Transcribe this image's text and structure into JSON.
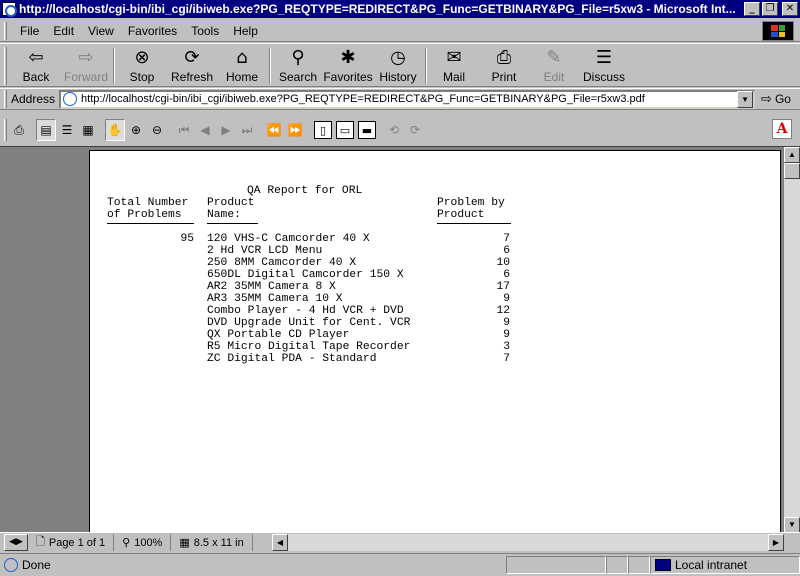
{
  "window": {
    "title": "http://localhost/cgi-bin/ibi_cgi/ibiweb.exe?PG_REQTYPE=REDIRECT&PG_Func=GETBINARY&PG_File=r5xw3 - Microsoft Int...",
    "minimize": "_",
    "restore": "❐",
    "close": "✕"
  },
  "menu": [
    "File",
    "Edit",
    "View",
    "Favorites",
    "Tools",
    "Help"
  ],
  "toolbar": [
    {
      "label": "Back",
      "icon": "back-arrow-icon",
      "glyph": "⇦",
      "enabled": true,
      "dropdown": true
    },
    {
      "label": "Forward",
      "icon": "forward-arrow-icon",
      "glyph": "⇨",
      "enabled": false,
      "dropdown": false
    },
    {
      "label": "Stop",
      "icon": "stop-icon",
      "glyph": "⊗",
      "enabled": true
    },
    {
      "label": "Refresh",
      "icon": "refresh-icon",
      "glyph": "⟳",
      "enabled": true
    },
    {
      "label": "Home",
      "icon": "home-icon",
      "glyph": "⌂",
      "enabled": true
    },
    {
      "label": "Search",
      "icon": "search-icon",
      "glyph": "⚲",
      "enabled": true
    },
    {
      "label": "Favorites",
      "icon": "favorites-icon",
      "glyph": "✱",
      "enabled": true
    },
    {
      "label": "History",
      "icon": "history-icon",
      "glyph": "◷",
      "enabled": true
    },
    {
      "label": "Mail",
      "icon": "mail-icon",
      "glyph": "✉",
      "enabled": true
    },
    {
      "label": "Print",
      "icon": "print-icon",
      "glyph": "⎙",
      "enabled": true
    },
    {
      "label": "Edit",
      "icon": "edit-icon",
      "glyph": "✎",
      "enabled": false
    },
    {
      "label": "Discuss",
      "icon": "discuss-icon",
      "glyph": "☰",
      "enabled": true
    }
  ],
  "address": {
    "label": "Address",
    "url": "http://localhost/cgi-bin/ibi_cgi/ibiweb.exe?PG_REQTYPE=REDIRECT&PG_Func=GETBINARY&PG_File=r5xw3.pdf",
    "go_label": "Go"
  },
  "report": {
    "title": "QA Report for ORL",
    "headers": {
      "col1_line1": "Total Number",
      "col1_line2": "of Problems",
      "col2_line1": "Product",
      "col2_line2": "Name:",
      "col3_line1": "Problem by",
      "col3_line2": "Product"
    },
    "total": "95",
    "rows": [
      {
        "product": "120 VHS-C Camcorder 40 X",
        "count": "7"
      },
      {
        "product": "2 Hd VCR LCD Menu",
        "count": "6"
      },
      {
        "product": "250 8MM Camcorder 40 X",
        "count": "10"
      },
      {
        "product": "650DL Digital Camcorder 150 X",
        "count": "6"
      },
      {
        "product": "AR2 35MM Camera 8 X",
        "count": "17"
      },
      {
        "product": "AR3 35MM Camera 10 X",
        "count": "9"
      },
      {
        "product": "Combo Player - 4 Hd VCR + DVD",
        "count": "12"
      },
      {
        "product": "DVD Upgrade Unit for Cent. VCR",
        "count": "9"
      },
      {
        "product": "QX Portable CD Player",
        "count": "9"
      },
      {
        "product": "R5 Micro Digital Tape Recorder",
        "count": "3"
      },
      {
        "product": "ZC Digital PDA - Standard",
        "count": "7"
      }
    ]
  },
  "navbar": {
    "page": "Page 1 of 1",
    "zoom": "100%",
    "page_size": "8.5 x 11 in"
  },
  "status": {
    "text": "Done",
    "zone": "Local intranet"
  }
}
